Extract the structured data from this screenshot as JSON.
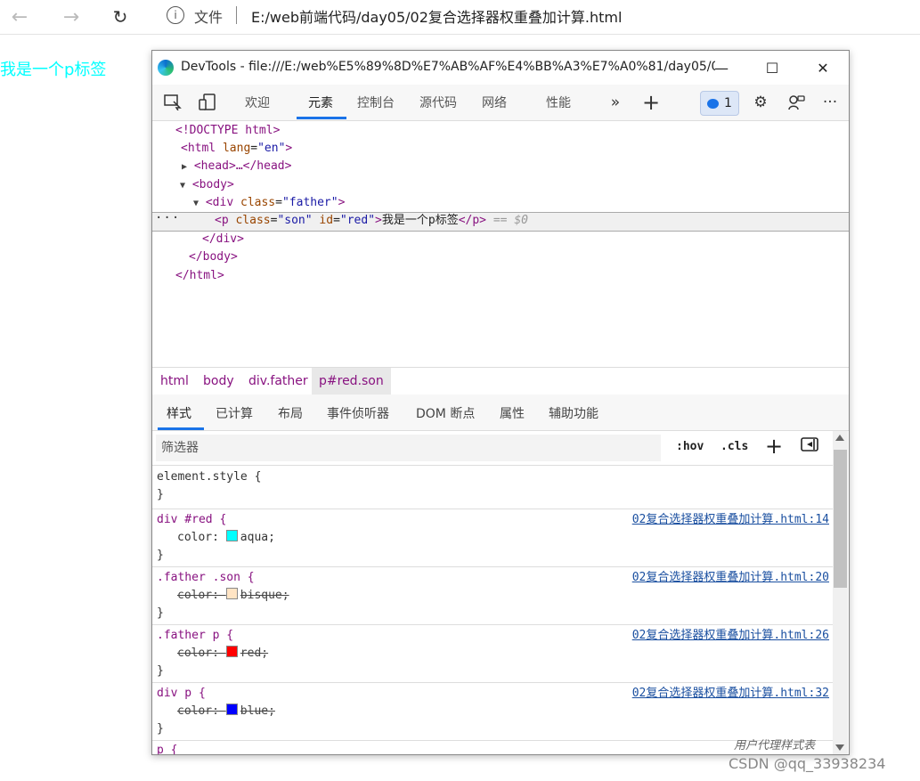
{
  "browser": {
    "file_label": "文件",
    "url": "E:/web前端代码/day05/02复合选择器权重叠加计算.html"
  },
  "page": {
    "paragraph": "我是一个p标签"
  },
  "devtools": {
    "title": "DevTools - file:///E:/web%E5%89%8D%E7%AB%AF%E4%BB%A3%E7%A0%81/day05/0...",
    "tabs": [
      "欢迎",
      "元素",
      "控制台",
      "源代码",
      "网络",
      "性能"
    ],
    "active_tab": "元素",
    "issues_count": "1",
    "dom": {
      "doctype": "<!DOCTYPE html>",
      "html_open_tag": "<html",
      "lang_attr": "lang",
      "lang_value": "\"en\"",
      "head": "<head>…</head>",
      "body_open": "<body>",
      "div_open_tag": "<div",
      "class_attr": "class",
      "father_value": "\"father\"",
      "p_open_tag": "<p",
      "son_value": "\"son\"",
      "id_attr": "id",
      "red_value": "\"red\"",
      "p_text": "我是一个p标签",
      "p_close": "</p>",
      "eq_marker": "== $0",
      "div_close": "</div>",
      "body_close": "</body>",
      "html_close": "</html>",
      "gt": ">"
    },
    "breadcrumbs": [
      "html",
      "body",
      "div.father",
      "p#red.son"
    ],
    "subtabs": [
      "样式",
      "已计算",
      "布局",
      "事件侦听器",
      "DOM 断点",
      "属性",
      "辅助功能"
    ],
    "filter_placeholder": "筛选器",
    "hov": ":hov",
    "cls": ".cls",
    "rules": [
      {
        "selector": "element.style {",
        "close": "}"
      },
      {
        "selector": "div #red {",
        "prop": "color:",
        "value": "aqua;",
        "swatch": "#00ffff",
        "struck": false,
        "source": "02复合选择器权重叠加计算.html:14",
        "close": "}"
      },
      {
        "selector": ".father .son {",
        "prop": "color:",
        "value": "bisque;",
        "swatch": "#ffe4c4",
        "struck": true,
        "source": "02复合选择器权重叠加计算.html:20",
        "close": "}"
      },
      {
        "selector": ".father p {",
        "prop": "color:",
        "value": "red;",
        "swatch": "#ff0000",
        "struck": true,
        "source": "02复合选择器权重叠加计算.html:26",
        "close": "}"
      },
      {
        "selector": "div p {",
        "prop": "color:",
        "value": "blue;",
        "swatch": "#0000ff",
        "struck": true,
        "source": "02复合选择器权重叠加计算.html:32",
        "close": "}"
      },
      {
        "selector": "p {"
      }
    ],
    "ua_label": "用户代理样式表"
  },
  "watermark": "CSDN @qq_33938234"
}
